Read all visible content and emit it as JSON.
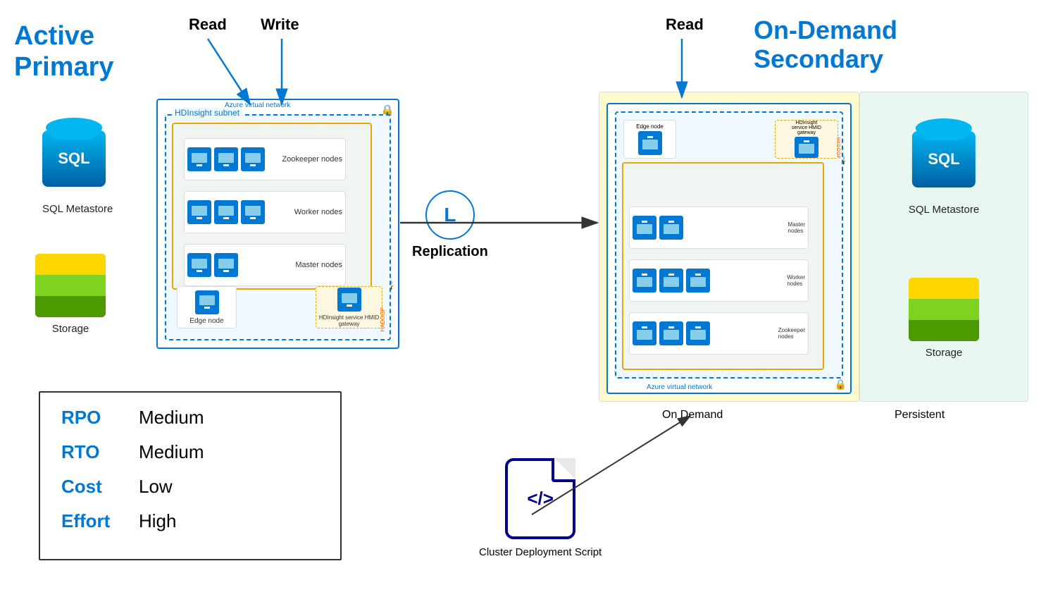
{
  "labels": {
    "active_primary": "Active\nPrimary",
    "active": "Active",
    "primary": "Primary",
    "read_left": "Read",
    "write": "Write",
    "read_right": "Read",
    "on_demand_secondary_line1": "On-Demand",
    "on_demand_secondary_line2": "Secondary",
    "sql_metastore": "SQL Metastore",
    "storage": "Storage",
    "replication": "Replication",
    "replication_circle": "L",
    "on_demand": "On Demand",
    "persistent": "Persistent",
    "cluster_deploy": "Cluster Deployment Script",
    "azure_vnet": "Azure virtual network",
    "hdinsight_subnet": "HDInsight subnet",
    "zookeeper_nodes": "Zookeeper\nnodes",
    "worker_nodes": "Worker\nnodes",
    "master_nodes": "Master\nnodes",
    "edge_node": "Edge\nnode",
    "gateway": "HDInsight\nservice HMID\ngateway",
    "vm": "VM",
    "sql_text": "SQL",
    "code_icon": "</>"
  },
  "info_box": {
    "rpo_key": "RPO",
    "rpo_value": "Medium",
    "rto_key": "RTO",
    "rto_value": "Medium",
    "cost_key": "Cost",
    "cost_value": "Low",
    "effort_key": "Effort",
    "effort_value": "High"
  },
  "colors": {
    "blue": "#0078d4",
    "dark_blue": "#00008b",
    "yellow_bg": "#fffacd",
    "green_bg": "#e8f8f0",
    "accent": "#0078d4"
  }
}
